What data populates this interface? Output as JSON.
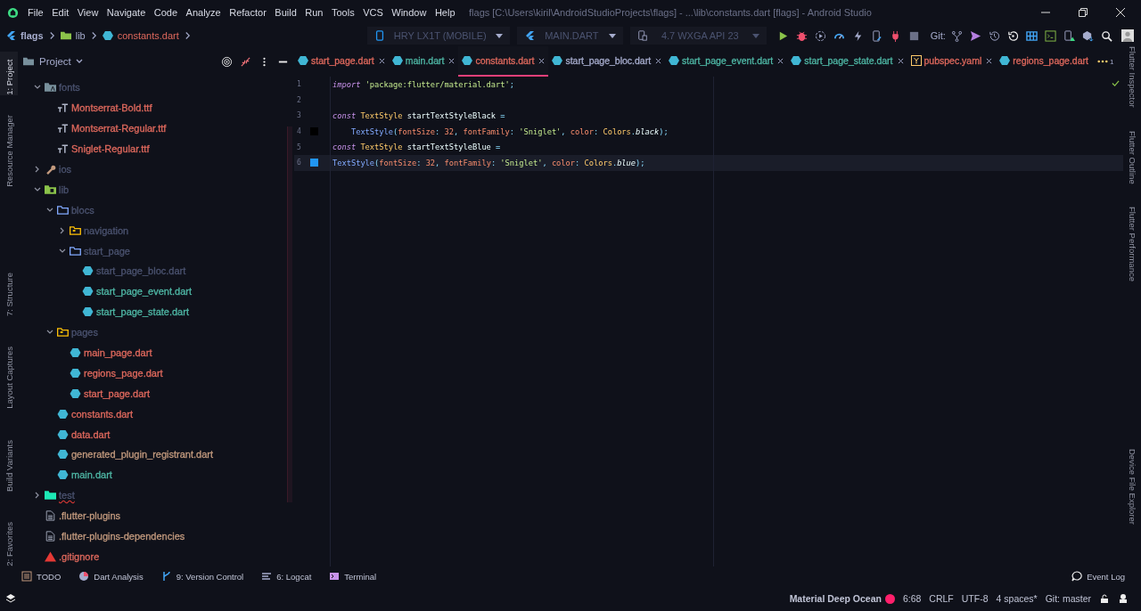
{
  "window": {
    "title": "flags [C:\\Users\\kiril\\AndroidStudioProjects\\flags] - ...\\lib\\constants.dart [flags] - Android Studio"
  },
  "menu": [
    "File",
    "Edit",
    "View",
    "Navigate",
    "Code",
    "Analyze",
    "Refactor",
    "Build",
    "Run",
    "Tools",
    "VCS",
    "Window",
    "Help"
  ],
  "breadcrumb": [
    {
      "label": "flags",
      "color": "#a6accd"
    },
    {
      "label": "lib",
      "color": "#a6accd"
    },
    {
      "label": "constants.dart",
      "color": "#e0695d"
    }
  ],
  "toolbar": {
    "device": "HRY LX1T (MOBILE)",
    "config": "MAIN.DART",
    "emulator": "4.7  WXGA API 23",
    "git_label": "Git:"
  },
  "left_strip": [
    {
      "label": "1: Project",
      "selected": true
    },
    {
      "label": "Resource Manager",
      "selected": false
    },
    {
      "label": "7: Structure",
      "selected": false
    },
    {
      "label": "Layout Captures",
      "selected": false
    },
    {
      "label": "Build Variants",
      "selected": false
    },
    {
      "label": "2: Favorites",
      "selected": false
    }
  ],
  "right_strip": [
    "Flutter Inspector",
    "Flutter Outline",
    "Flutter Performance",
    "Device File Explorer"
  ],
  "project": {
    "title": "Project",
    "tree": [
      {
        "label": "fonts",
        "kind": "fonts-folder",
        "color": "#4b5370",
        "expanded": true,
        "children": [
          {
            "label": "Montserrat-Bold.ttf",
            "kind": "font-file",
            "color": "#e0695d"
          },
          {
            "label": "Montserrat-Regular.ttf",
            "kind": "font-file",
            "color": "#e0695d"
          },
          {
            "label": "Sniglet-Regular.ttf",
            "kind": "font-file",
            "color": "#e0695d"
          }
        ]
      },
      {
        "label": "ios",
        "kind": "ios-folder",
        "color": "#4b5370",
        "expanded": false
      },
      {
        "label": "lib",
        "kind": "lib-folder",
        "color": "#4b5370",
        "expanded": true,
        "children": [
          {
            "label": "blocs",
            "kind": "folder",
            "color": "#4b5370",
            "expanded": true,
            "children": [
              {
                "label": "navigation",
                "kind": "package-folder",
                "color": "#4b5370",
                "expanded": false
              },
              {
                "label": "start_page",
                "kind": "folder",
                "color": "#4b5370",
                "expanded": true,
                "children": [
                  {
                    "label": "start_page_bloc.dart",
                    "kind": "dart-file",
                    "color": "#4b5370"
                  },
                  {
                    "label": "start_page_event.dart",
                    "kind": "dart-file",
                    "color": "#4fb8a6"
                  },
                  {
                    "label": "start_page_state.dart",
                    "kind": "dart-file",
                    "color": "#4fb8a6"
                  }
                ]
              }
            ]
          },
          {
            "label": "pages",
            "kind": "package-folder",
            "color": "#4b5370",
            "expanded": true,
            "children": [
              {
                "label": "main_page.dart",
                "kind": "dart-file",
                "color": "#e0695d"
              },
              {
                "label": "regions_page.dart",
                "kind": "dart-file",
                "color": "#e0695d"
              },
              {
                "label": "start_page.dart",
                "kind": "dart-file",
                "color": "#e0695d"
              }
            ]
          },
          {
            "label": "constants.dart",
            "kind": "dart-file",
            "color": "#e0695d"
          },
          {
            "label": "data.dart",
            "kind": "dart-file",
            "color": "#e0695d"
          },
          {
            "label": "generated_plugin_registrant.dart",
            "kind": "dart-file",
            "color": "#c39a7e"
          },
          {
            "label": "main.dart",
            "kind": "dart-file",
            "color": "#4fb8a6"
          }
        ]
      },
      {
        "label": "test",
        "kind": "test-folder",
        "color": "#4b5370",
        "expanded": false,
        "error": true
      },
      {
        "label": ".flutter-plugins",
        "kind": "text-file",
        "color": "#c39a7e"
      },
      {
        "label": ".flutter-plugins-dependencies",
        "kind": "text-file",
        "color": "#c39a7e"
      },
      {
        "label": ".gitignore",
        "kind": "git-file",
        "color": "#e0695d"
      }
    ]
  },
  "tabs": [
    {
      "label": "start_page.dart",
      "kind": "dart",
      "color": "#e0695d",
      "selected": false,
      "closable": true
    },
    {
      "label": "main.dart",
      "kind": "dart",
      "color": "#4fb8a6",
      "selected": false,
      "closable": true
    },
    {
      "label": "constants.dart",
      "kind": "dart",
      "color": "#e0695d",
      "selected": true,
      "closable": true
    },
    {
      "label": "start_page_bloc.dart",
      "kind": "dart",
      "color": "#a6accd",
      "selected": false,
      "closable": true
    },
    {
      "label": "start_page_event.dart",
      "kind": "dart",
      "color": "#4fb8a6",
      "selected": false,
      "closable": true
    },
    {
      "label": "start_page_state.dart",
      "kind": "dart",
      "color": "#4fb8a6",
      "selected": false,
      "closable": true
    },
    {
      "label": "pubspec.yaml",
      "kind": "yaml",
      "color": "#e0695d",
      "selected": false,
      "closable": true
    },
    {
      "label": "regions_page.dart",
      "kind": "dart",
      "color": "#e0695d",
      "selected": false,
      "closable": false
    }
  ],
  "tab_overflow": "1",
  "code": [
    {
      "number": "1",
      "current": false,
      "tokens": [
        {
          "kind": "kw",
          "t": "import "
        },
        {
          "kind": "str",
          "t": "'package:flutter/material.dart'"
        },
        {
          "kind": "op",
          "t": ";"
        }
      ]
    },
    {
      "number": "2",
      "current": false
    },
    {
      "number": "3",
      "current": false,
      "tokens": [
        {
          "kind": "kw",
          "t": "const "
        },
        {
          "kind": "type",
          "t": "TextStyle "
        },
        {
          "kind": "var",
          "t": "startTextStyleBlack "
        },
        {
          "kind": "op",
          "t": "="
        }
      ]
    },
    {
      "number": "4",
      "current": false,
      "color": "#000000",
      "tokens": [
        {
          "kind": "fn",
          "t": "    TextStyle"
        },
        {
          "kind": "op",
          "t": "("
        },
        {
          "kind": "param",
          "t": "fontSize"
        },
        {
          "kind": "op",
          "t": ": "
        },
        {
          "kind": "num",
          "t": "32"
        },
        {
          "kind": "op",
          "t": ", "
        },
        {
          "kind": "param",
          "t": "fontFamily"
        },
        {
          "kind": "op",
          "t": ": "
        },
        {
          "kind": "str",
          "t": "'Sniglet'"
        },
        {
          "kind": "op",
          "t": ", "
        },
        {
          "kind": "param",
          "t": "color"
        },
        {
          "kind": "op",
          "t": ": "
        },
        {
          "kind": "type",
          "t": "Colors"
        },
        {
          "kind": "op",
          "t": "."
        },
        {
          "kind": "prop",
          "t": "black"
        },
        {
          "kind": "op",
          "t": ");"
        }
      ]
    },
    {
      "number": "5",
      "current": false,
      "tokens": [
        {
          "kind": "kw",
          "t": "const "
        },
        {
          "kind": "type",
          "t": "TextStyle "
        },
        {
          "kind": "var",
          "t": "startTextStyleBlue "
        },
        {
          "kind": "op",
          "t": "="
        }
      ]
    },
    {
      "number": "6",
      "current": true,
      "color": "#2196f3",
      "tokens": [
        {
          "kind": "fn",
          "t": "TextStyle"
        },
        {
          "kind": "op",
          "t": "("
        },
        {
          "kind": "param",
          "t": "fontSize"
        },
        {
          "kind": "op",
          "t": ": "
        },
        {
          "kind": "num",
          "t": "32"
        },
        {
          "kind": "op",
          "t": ", "
        },
        {
          "kind": "param",
          "t": "fontFamily"
        },
        {
          "kind": "op",
          "t": ": "
        },
        {
          "kind": "str",
          "t": "'Sniglet'"
        },
        {
          "kind": "op",
          "t": ", "
        },
        {
          "kind": "param",
          "t": "color"
        },
        {
          "kind": "op",
          "t": ": "
        },
        {
          "kind": "type",
          "t": "Colors"
        },
        {
          "kind": "op",
          "t": "."
        },
        {
          "kind": "prop",
          "t": "blue"
        },
        {
          "kind": "op",
          "t": ");"
        }
      ]
    }
  ],
  "bottom_tools": [
    {
      "label": "TODO",
      "kind": "todo"
    },
    {
      "label": "Dart Analysis",
      "kind": "analysis"
    },
    {
      "label": "9: Version Control",
      "kind": "vcs"
    },
    {
      "label": "6: Logcat",
      "kind": "logcat"
    },
    {
      "label": "Terminal",
      "kind": "terminal"
    }
  ],
  "event_log": "Event Log",
  "status_bar": {
    "theme": "Material Deep Ocean",
    "position": "6:68",
    "line_separator": "CRLF",
    "encoding": "UTF-8",
    "indent": "4 spaces*",
    "branch": "Git: master"
  }
}
